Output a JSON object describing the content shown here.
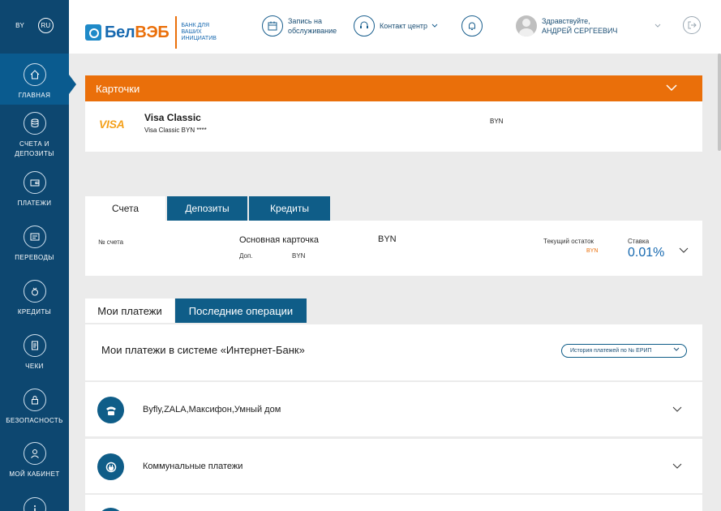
{
  "lang": {
    "by": "BY",
    "ru": "RU"
  },
  "sidebar": {
    "items": [
      {
        "label": "ГЛАВНАЯ",
        "icon": "home-icon"
      },
      {
        "label": "СЧЕТА И ДЕПОЗИТЫ",
        "icon": "coins-icon"
      },
      {
        "label": "ПЛАТЕЖИ",
        "icon": "wallet-icon"
      },
      {
        "label": "ПЕРЕВОДЫ",
        "icon": "transfer-icon"
      },
      {
        "label": "КРЕДИТЫ",
        "icon": "money-bag-icon"
      },
      {
        "label": "ЧЕКИ",
        "icon": "receipt-icon"
      },
      {
        "label": "БЕЗОПАСНОСТЬ",
        "icon": "lock-icon"
      },
      {
        "label": "МОЙ КАБИНЕТ",
        "icon": "user-icon"
      }
    ]
  },
  "header": {
    "logo": {
      "name_a": "Бел",
      "name_b": "ВЭБ",
      "tagline": "БАНК ДЛЯ ВАШИХ ИНИЦИАТИВ"
    },
    "appointment": "Запись на обслуживание",
    "contact": "Контакт центр",
    "greeting": "Здравствуйте,",
    "user_name": "АНДРЕЙ СЕРГЕЕВИЧ"
  },
  "cards": {
    "title": "Карточки",
    "brand": "VISA",
    "card_name": "Visa Classic",
    "card_sub": "Visa Classic BYN ****",
    "currency": "BYN"
  },
  "account_tabs": [
    "Счета",
    "Депозиты",
    "Кредиты"
  ],
  "account": {
    "number_label": "№ счета",
    "name": "Основная карточка",
    "currency": "BYN",
    "add_label": "Доп.",
    "add_currency": "BYN",
    "balance_label": "Текущий остаток",
    "balance_currency": "BYN",
    "rate_label": "Ставка",
    "rate_value": "0.01%"
  },
  "payment_tabs": [
    "Мои платежи",
    "Последние операции"
  ],
  "payments": {
    "title": "Мои платежи в системе «Интернет-Банк»",
    "erip_button": "История платежей по № ЕРИП",
    "rows": [
      {
        "label": "Byfly,ZALA,Максифон,Умный дом",
        "icon": "phone-icon"
      },
      {
        "label": "Коммунальные платежи",
        "icon": "power-plug-icon"
      }
    ]
  }
}
